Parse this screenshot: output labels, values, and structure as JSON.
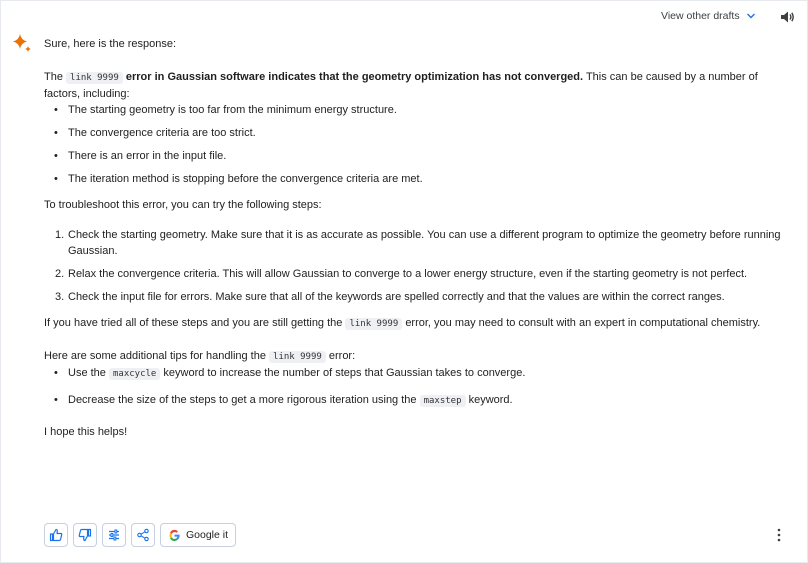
{
  "header": {
    "view_drafts_label": "View other drafts",
    "speaker_icon": "volume-icon"
  },
  "response": {
    "intro": "Sure, here is the response:",
    "para1": {
      "the": "The",
      "code": "link 9999",
      "bold_rest": "error in Gaussian software indicates that the geometry optimization has not converged.",
      "tail": "This can be caused by a number of factors, including:"
    },
    "causes": [
      "The starting geometry is too far from the minimum energy structure.",
      "The convergence criteria are too strict.",
      "There is an error in the input file.",
      "The iteration method is stopping before the convergence criteria are met."
    ],
    "troubleshoot_heading": "To troubleshoot this error, you can try the following steps:",
    "steps": [
      {
        "num": "1.",
        "text": "Check the starting geometry. Make sure that it is as accurate as possible. You can use a different program to optimize the geometry before running Gaussian."
      },
      {
        "num": "2.",
        "text": "Relax the convergence criteria. This will allow Gaussian to converge to a lower energy structure, even if the starting geometry is not perfect."
      },
      {
        "num": "3.",
        "text": "Check the input file for errors. Make sure that all of the keywords are spelled correctly and that the values are within the correct ranges."
      }
    ],
    "para3": {
      "before": "If you have tried all of these steps and you are still getting the",
      "code": "link 9999",
      "after": "error, you may need to consult with an expert in computational chemistry."
    },
    "para4": {
      "before": "Here are some additional tips for handling the",
      "code": "link 9999",
      "after": "error:"
    },
    "tips": [
      {
        "before": "Use the",
        "code": "maxcycle",
        "after": "keyword to increase the number of steps that Gaussian takes to converge."
      },
      {
        "before": "Decrease the size of the steps to get a more rigorous iteration using the",
        "code": "maxstep",
        "after": "keyword."
      }
    ],
    "closing": "I hope this helps!"
  },
  "actions": {
    "google_label": "Google it",
    "icons": [
      "thumbs-up-icon",
      "thumbs-down-icon",
      "tune-icon",
      "share-icon",
      "more-vert-icon"
    ]
  },
  "colors": {
    "accent_blue": "#1a73e8",
    "spark_orange": "#e8710a",
    "code_bg": "#eef0f4"
  }
}
